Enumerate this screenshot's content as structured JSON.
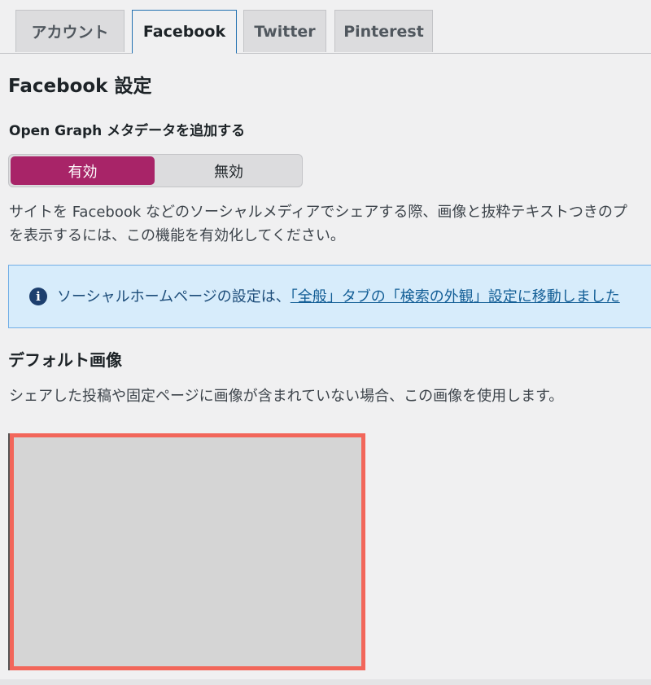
{
  "tabs": {
    "account": "アカウント",
    "facebook": "Facebook",
    "twitter": "Twitter",
    "pinterest": "Pinterest",
    "active": "Facebook"
  },
  "section": {
    "title": "Facebook 設定"
  },
  "open_graph": {
    "label": "Open Graph メタデータを追加する",
    "toggle_on": "有効",
    "toggle_off": "無効",
    "selected": "有効",
    "description_line1": "サイトを Facebook などのソーシャルメディアでシェアする際、画像と抜粋テキストつきのプ",
    "description_line2": "を表示するには、この機能を有効化してください。"
  },
  "notice": {
    "icon": "info-icon",
    "text_before": "ソーシャルホームページの設定は、",
    "link_text": "「全般」タブの「検索の外観」設定に移動しました"
  },
  "default_image": {
    "title": "デフォルト画像",
    "description": "シェアした投稿や固定ページに画像が含まれていない場合、この画像を使用します。"
  },
  "colors": {
    "accent": "#a82468",
    "highlight_border": "#f2665a",
    "notice_bg": "#d7ecfb"
  }
}
